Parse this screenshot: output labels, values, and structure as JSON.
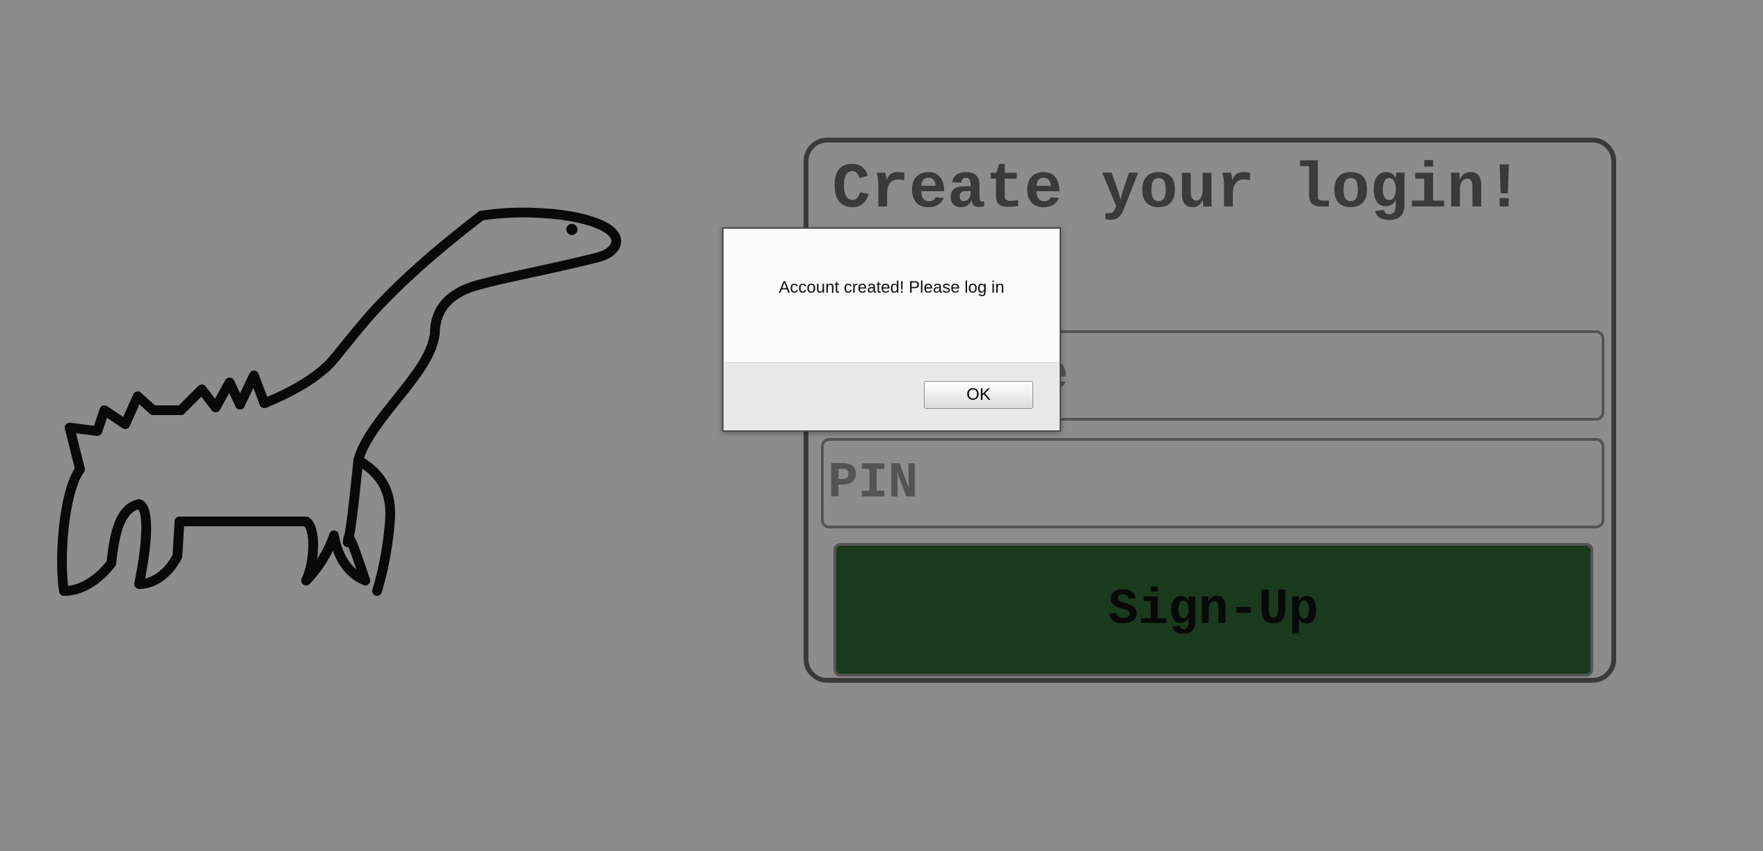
{
  "signup_form": {
    "title": "Create your login!",
    "username_placeholder": "Username",
    "pin_placeholder": "PIN",
    "submit_label": "Sign-Up"
  },
  "alert_dialog": {
    "message": "Account created! Please log in",
    "ok_label": "OK"
  },
  "illustration": {
    "icon": "dinosaur-icon"
  },
  "colors": {
    "button_green": "#2f6b35",
    "overlay_dim": "#888888"
  }
}
